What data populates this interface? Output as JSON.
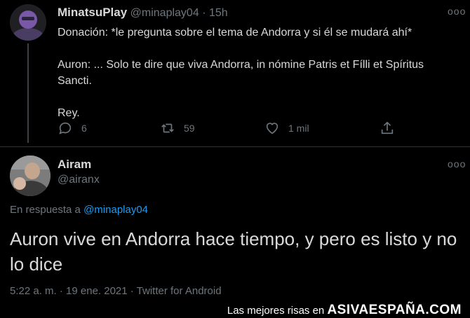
{
  "tweet1": {
    "name": "MinatsuPlay",
    "handle": "@minaplay04",
    "sep": "·",
    "time": "15h",
    "more_label": "ooo",
    "line1": "Donación: *le pregunta sobre el tema de Andorra y si él se mudará ahí*",
    "line2": "Auron: ... Solo te dire que viva Andorra, in nómine Patris et Fílli et Spíritus",
    "line3": "Sancti.",
    "line4": "Rey.",
    "actions": {
      "reply_icon": "comment-icon",
      "reply_count": "6",
      "retweet_icon": "retweet-icon",
      "retweet_count": "59",
      "like_icon": "heart-icon",
      "like_count": "1 mil",
      "share_icon": "share-icon"
    }
  },
  "tweet2": {
    "name": "Airam",
    "handle": "@airanx",
    "more_label": "ooo",
    "reply_prefix": "En respuesta a",
    "reply_mention": "@minaplay04",
    "text_line1": "Auron vive en Andorra hace tiempo, y pero es listo y no",
    "text_line2": "lo dice",
    "timestamp": "5:22 a. m. · 19 ene. 2021 · Twitter for Android"
  },
  "footer": {
    "prefix": "Las mejores risas en",
    "brand": "ASIVAESPAÑA.COM"
  },
  "colors": {
    "background": "#000000",
    "text": "#d9d9d9",
    "muted": "#6e767d",
    "link": "#1d9bf0"
  }
}
